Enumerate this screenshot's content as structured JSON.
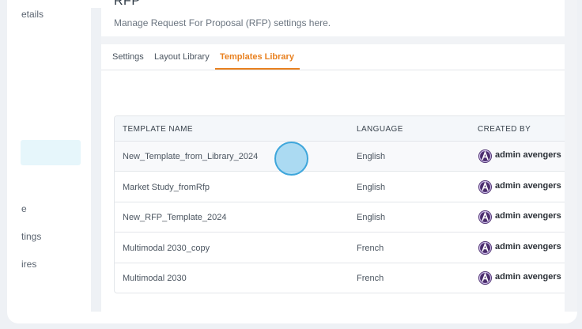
{
  "sidebar": {
    "items": [
      {
        "label": "etails"
      },
      {
        "label": "e"
      },
      {
        "label": "tings"
      },
      {
        "label": "ires"
      }
    ]
  },
  "header": {
    "title": "RFP",
    "subtitle": "Manage Request For Proposal (RFP) settings here."
  },
  "tabs": [
    {
      "label": "Settings",
      "active": false
    },
    {
      "label": "Layout Library",
      "active": false
    },
    {
      "label": "Templates Library",
      "active": true
    }
  ],
  "table": {
    "columns": [
      "TEMPLATE NAME",
      "LANGUAGE",
      "CREATED BY"
    ],
    "rows": [
      {
        "name": "New_Template_from_Library_2024",
        "language": "English",
        "created_by": "admin avengers"
      },
      {
        "name": "Market Study_fromRfp",
        "language": "English",
        "created_by": "admin avengers"
      },
      {
        "name": "New_RFP_Template_2024",
        "language": "English",
        "created_by": "admin avengers"
      },
      {
        "name": "Multimodal 2030_copy",
        "language": "French",
        "created_by": "admin avengers"
      },
      {
        "name": "Multimodal 2030",
        "language": "French",
        "created_by": "admin avengers"
      }
    ]
  },
  "colors": {
    "accent": "#e8801f",
    "highlight": "#e6f6fb",
    "avatar": "#4a2d6d"
  },
  "icons": {
    "avatar": "avengers-logo-icon"
  }
}
